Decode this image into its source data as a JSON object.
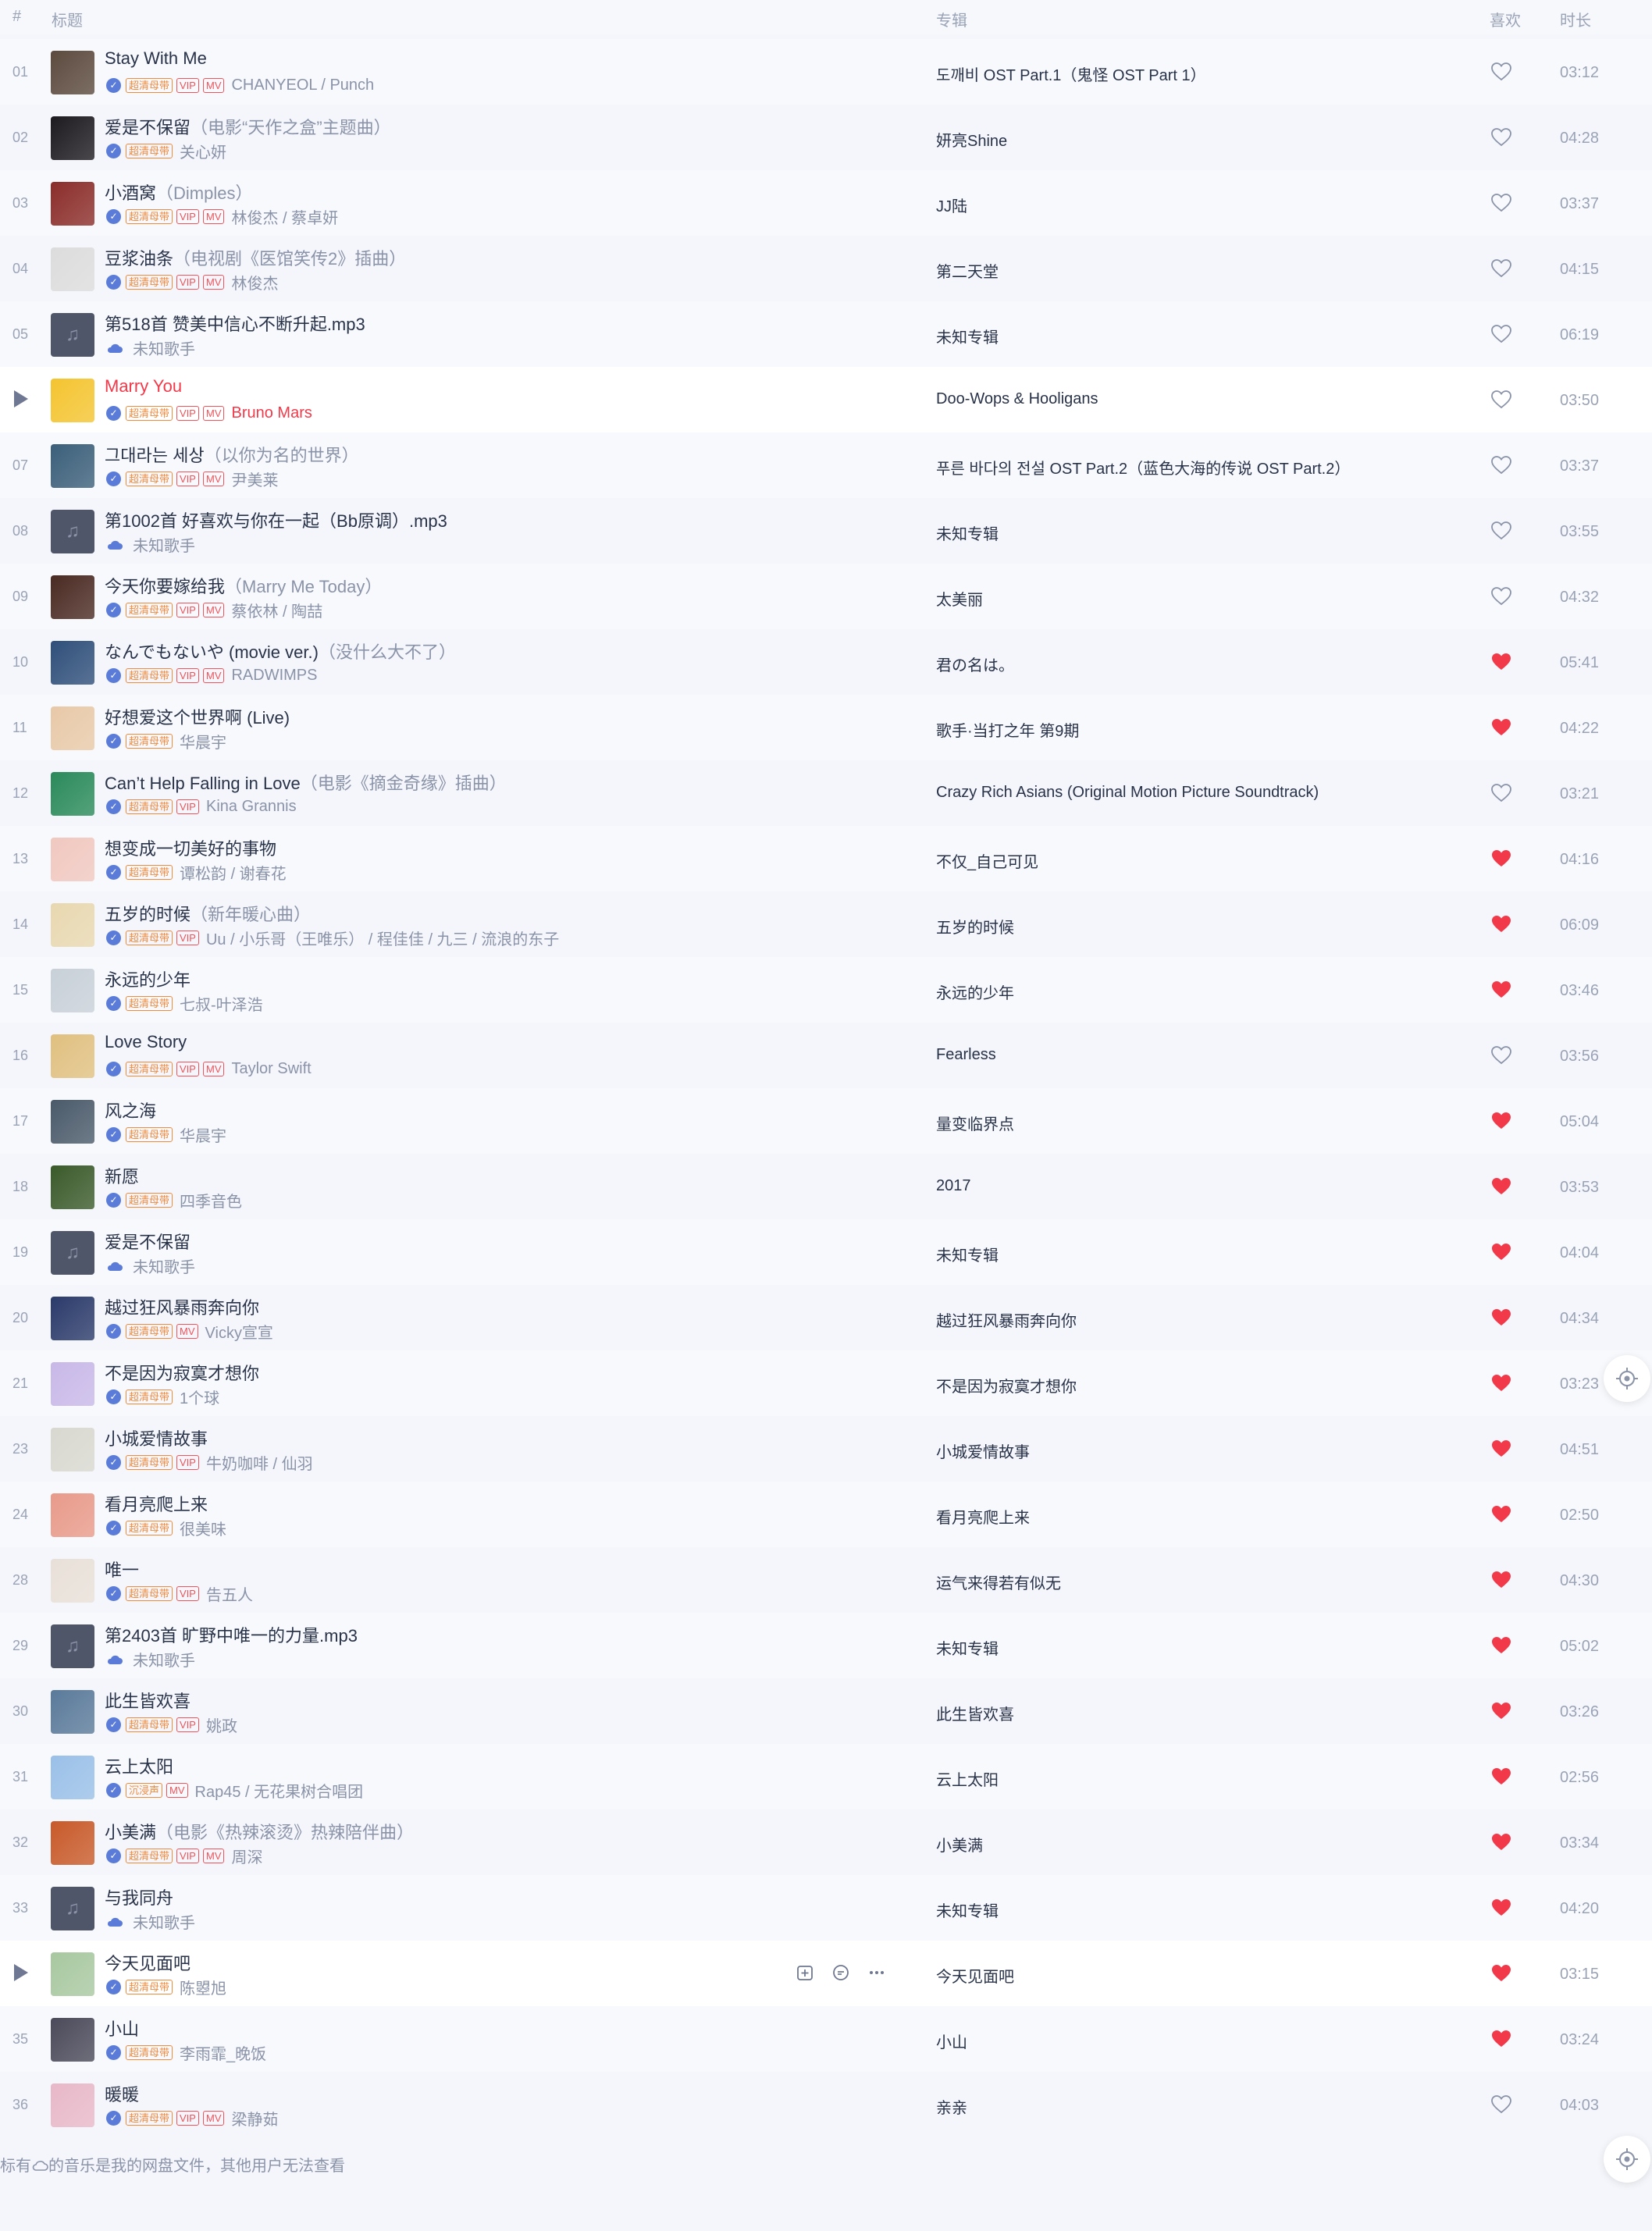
{
  "header": {
    "index": "#",
    "title": "标题",
    "album": "专辑",
    "like": "喜欢",
    "duration": "时长"
  },
  "colors": {
    "accent": "#f2394a",
    "text": "#283248",
    "muted": "#8a93a8",
    "vip": "#f0545a",
    "hq": "#f08a3c",
    "verified": "#5a7cd8"
  },
  "songs": [
    {
      "index": "01",
      "title": "Stay With Me",
      "subtitle": "",
      "tags": [
        "超清母带",
        "VIP",
        "MV"
      ],
      "artist": "CHANYEOL / Punch",
      "album": "도깨비 OST Part.1（鬼怪 OST Part 1）",
      "liked": false,
      "duration": "03:12",
      "cover": "#5c4a3e"
    },
    {
      "index": "02",
      "title": "爱是不保留",
      "subtitle": "（电影“天作之盒”主题曲）",
      "tags": [
        "超清母带"
      ],
      "artist": "关心妍",
      "album": "妍亮Shine",
      "liked": false,
      "duration": "04:28",
      "cover": "#1d1a1f"
    },
    {
      "index": "03",
      "title": "小酒窝",
      "subtitle": "（Dimples）",
      "tags": [
        "超清母带",
        "VIP",
        "MV"
      ],
      "artist": "林俊杰 / 蔡卓妍",
      "album": "JJ陆",
      "liked": false,
      "duration": "03:37",
      "cover": "#8b2d2a"
    },
    {
      "index": "04",
      "title": "豆浆油条",
      "subtitle": "（电视剧《医馆笑传2》插曲）",
      "tags": [
        "超清母带",
        "VIP",
        "MV"
      ],
      "artist": "林俊杰",
      "album": "第二天堂",
      "liked": false,
      "duration": "04:15",
      "cover": "#dcdcdc"
    },
    {
      "index": "05",
      "title": "第518首 赞美中信心不断升起.mp3",
      "subtitle": "",
      "tags": [],
      "cloud": true,
      "artist": "未知歌手",
      "album": "未知专辑",
      "liked": false,
      "duration": "06:19",
      "cover": ""
    },
    {
      "index": "",
      "playing": true,
      "title": "Marry You",
      "subtitle": "",
      "tags": [
        "超清母带",
        "VIP",
        "MV"
      ],
      "artist": "Bruno Mars",
      "album": "Doo-Wops & Hooligans",
      "liked": false,
      "duration": "03:50",
      "cover": "#f4c430"
    },
    {
      "index": "07",
      "title": "그대라는 세상",
      "subtitle": "（以你为名的世界）",
      "tags": [
        "超清母带",
        "VIP",
        "MV"
      ],
      "artist": "尹美莱",
      "album": "푸른 바다의 전설 OST Part.2（蓝色大海的传说 OST Part.2）",
      "liked": false,
      "duration": "03:37",
      "cover": "#3b5f7a"
    },
    {
      "index": "08",
      "title": "第1002首 好喜欢与你在一起（Bb原调）.mp3",
      "subtitle": "",
      "tags": [],
      "cloud": true,
      "artist": "未知歌手",
      "album": "未知专辑",
      "liked": false,
      "duration": "03:55",
      "cover": ""
    },
    {
      "index": "09",
      "title": "今天你要嫁给我",
      "subtitle": "（Marry Me Today）",
      "tags": [
        "超清母带",
        "VIP",
        "MV"
      ],
      "artist": "蔡依林 / 陶喆",
      "album": "太美丽",
      "liked": false,
      "duration": "04:32",
      "cover": "#4a2a22"
    },
    {
      "index": "10",
      "title": "なんでもないや (movie ver.)",
      "subtitle": "（没什么大不了）",
      "tags": [
        "超清母带",
        "VIP",
        "MV"
      ],
      "artist": "RADWIMPS",
      "album": "君の名は。",
      "liked": true,
      "duration": "05:41",
      "cover": "#2f4f7a"
    },
    {
      "index": "11",
      "title": "好想爱这个世界啊 (Live)",
      "subtitle": "",
      "tags": [
        "超清母带"
      ],
      "artist": "华晨宇",
      "album": "歌手·当打之年 第9期",
      "liked": true,
      "duration": "04:22",
      "cover": "#e8c9a8"
    },
    {
      "index": "12",
      "title": "Can’t Help Falling in Love",
      "subtitle": "（电影《摘金奇缘》插曲）",
      "tags": [
        "超清母带",
        "VIP"
      ],
      "artist": "Kina Grannis",
      "album": "Crazy Rich Asians (Original Motion Picture Soundtrack)",
      "liked": false,
      "duration": "03:21",
      "cover": "#2a8a5a"
    },
    {
      "index": "13",
      "title": "想变成一切美好的事物",
      "subtitle": "",
      "tags": [
        "超清母带"
      ],
      "artist": "谭松韵 / 谢春花",
      "album": "不仅_自己可见",
      "liked": true,
      "duration": "04:16",
      "cover": "#f0c8c0"
    },
    {
      "index": "14",
      "title": "五岁的时候",
      "subtitle": "（新年暖心曲）",
      "tags": [
        "超清母带",
        "VIP"
      ],
      "artist": "Uu / 小乐哥（王唯乐） / 程佳佳 / 九三 / 流浪的东子",
      "album": "五岁的时候",
      "liked": true,
      "duration": "06:09",
      "cover": "#e8d8b0"
    },
    {
      "index": "15",
      "title": "永远的少年",
      "subtitle": "",
      "tags": [
        "超清母带"
      ],
      "artist": "七叔-叶泽浩",
      "album": "永远的少年",
      "liked": true,
      "duration": "03:46",
      "cover": "#c8d0d8"
    },
    {
      "index": "16",
      "title": "Love Story",
      "subtitle": "",
      "tags": [
        "超清母带",
        "VIP",
        "MV"
      ],
      "artist": "Taylor Swift",
      "album": "Fearless",
      "liked": false,
      "duration": "03:56",
      "cover": "#e0c080"
    },
    {
      "index": "17",
      "title": "风之海",
      "subtitle": "",
      "tags": [
        "超清母带"
      ],
      "artist": "华晨宇",
      "album": "量变临界点",
      "liked": true,
      "duration": "05:04",
      "cover": "#4a5a6a"
    },
    {
      "index": "18",
      "title": "新愿",
      "subtitle": "",
      "tags": [
        "超清母带"
      ],
      "artist": "四季音色",
      "album": "2017",
      "liked": true,
      "duration": "03:53",
      "cover": "#3a5a2a"
    },
    {
      "index": "19",
      "title": "爱是不保留",
      "subtitle": "",
      "tags": [],
      "cloud": true,
      "artist": "未知歌手",
      "album": "未知专辑",
      "liked": true,
      "duration": "04:04",
      "cover": ""
    },
    {
      "index": "20",
      "title": "越过狂风暴雨奔向你",
      "subtitle": "",
      "tags": [
        "超清母带",
        "MV"
      ],
      "artist": "Vicky宣宣",
      "album": "越过狂风暴雨奔向你",
      "liked": true,
      "duration": "04:34",
      "cover": "#2a3a6a"
    },
    {
      "index": "21",
      "title": "不是因为寂寞才想你",
      "subtitle": "",
      "tags": [
        "超清母带"
      ],
      "artist": "1个球",
      "album": "不是因为寂寞才想你",
      "liked": true,
      "duration": "03:23",
      "cover": "#c8b8e8"
    },
    {
      "index": "23",
      "title": "小城爱情故事",
      "subtitle": "",
      "tags": [
        "超清母带",
        "VIP"
      ],
      "artist": "牛奶咖啡 / 仙羽",
      "album": "小城爱情故事",
      "liked": true,
      "duration": "04:51",
      "cover": "#d8d8d0"
    },
    {
      "index": "24",
      "title": "看月亮爬上来",
      "subtitle": "",
      "tags": [
        "超清母带"
      ],
      "artist": "很美味",
      "album": "看月亮爬上来",
      "liked": true,
      "duration": "02:50",
      "cover": "#e89a8a"
    },
    {
      "index": "28",
      "title": "唯一",
      "subtitle": "",
      "tags": [
        "超清母带",
        "VIP"
      ],
      "artist": "告五人",
      "album": "运气来得若有似无",
      "liked": true,
      "duration": "04:30",
      "cover": "#e8e0d8"
    },
    {
      "index": "29",
      "title": "第2403首 旷野中唯一的力量.mp3",
      "subtitle": "",
      "tags": [],
      "cloud": true,
      "artist": "未知歌手",
      "album": "未知专辑",
      "liked": true,
      "duration": "05:02",
      "cover": ""
    },
    {
      "index": "30",
      "title": "此生皆欢喜",
      "subtitle": "",
      "tags": [
        "超清母带",
        "VIP"
      ],
      "artist": "姚政",
      "album": "此生皆欢喜",
      "liked": true,
      "duration": "03:26",
      "cover": "#5a7a9a"
    },
    {
      "index": "31",
      "title": "云上太阳",
      "subtitle": "",
      "tags": [
        "沉浸声",
        "MV"
      ],
      "artist": "Rap45 / 无花果树合唱团",
      "album": "云上太阳",
      "liked": true,
      "duration": "02:56",
      "cover": "#9ac0e8"
    },
    {
      "index": "32",
      "title": "小美满",
      "subtitle": "（电影《热辣滚烫》热辣陪伴曲）",
      "tags": [
        "超清母带",
        "VIP",
        "MV"
      ],
      "artist": "周深",
      "album": "小美满",
      "liked": true,
      "duration": "03:34",
      "cover": "#c85a2a"
    },
    {
      "index": "33",
      "title": "与我同舟",
      "subtitle": "",
      "tags": [],
      "cloud": true,
      "artist": "未知歌手",
      "album": "未知专辑",
      "liked": true,
      "duration": "04:20",
      "cover": ""
    },
    {
      "index": "",
      "playing": false,
      "hover": true,
      "title": "今天见面吧",
      "subtitle": "",
      "tags": [
        "超清母带"
      ],
      "artist": "陈曌旭",
      "album": "今天见面吧",
      "liked": true,
      "duration": "03:15",
      "cover": "#a8c8a0"
    },
    {
      "index": "35",
      "title": "小山",
      "subtitle": "",
      "tags": [
        "超清母带"
      ],
      "artist": "李雨霏_晚饭",
      "album": "小山",
      "liked": true,
      "duration": "03:24",
      "cover": "#4a4a5a"
    },
    {
      "index": "36",
      "title": "暖暖",
      "subtitle": "",
      "tags": [
        "超清母带",
        "VIP",
        "MV"
      ],
      "artist": "梁静茹",
      "album": "亲亲",
      "liked": false,
      "duration": "04:03",
      "cover": "#e8b8c8"
    }
  ],
  "footer": {
    "note_prefix": "标有",
    "note_suffix": "的音乐是我的网盘文件，其他用户无法查看"
  },
  "icons": {
    "heart": "heart-icon",
    "play": "play-icon",
    "locate": "locate-icon",
    "cloud": "cloud-icon",
    "verified": "verified-icon"
  }
}
